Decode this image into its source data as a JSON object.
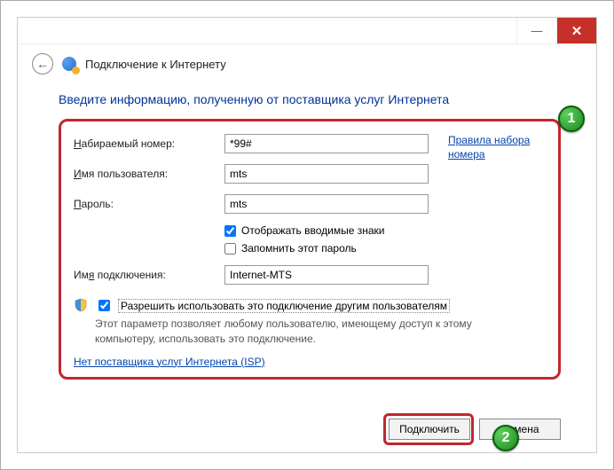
{
  "window": {
    "title": "Подключение к Интернету"
  },
  "instruction": "Введите информацию, полученную от поставщика услуг Интернета",
  "labels": {
    "dial_number": "Набираемый номер:",
    "dial_underline": "Н",
    "username": "Имя пользователя:",
    "username_underline": "И",
    "password": "Пароль:",
    "password_underline": "П",
    "conn_name": "Имя подключения:",
    "conn_underline": "я"
  },
  "values": {
    "dial_number": "*99#",
    "username": "mts",
    "password": "mts",
    "conn_name": "Internet-MTS"
  },
  "checkboxes": {
    "show_chars": "Отображать вводимые знаки",
    "show_chars_checked": true,
    "remember": "Запомнить этот пароль",
    "remember_checked": false,
    "allow_others": "Разрешить использовать это подключение другим пользователям",
    "allow_others_checked": true
  },
  "share_desc": "Этот параметр позволяет любому пользователю, имеющему доступ к этому компьютеру, использовать это подключение.",
  "links": {
    "dial_rules": "Правила набора номера",
    "no_isp": "Нет поставщика услуг Интернета (ISP)"
  },
  "buttons": {
    "connect": "Подключить",
    "cancel": "Отмена"
  },
  "badges": {
    "one": "1",
    "two": "2"
  }
}
